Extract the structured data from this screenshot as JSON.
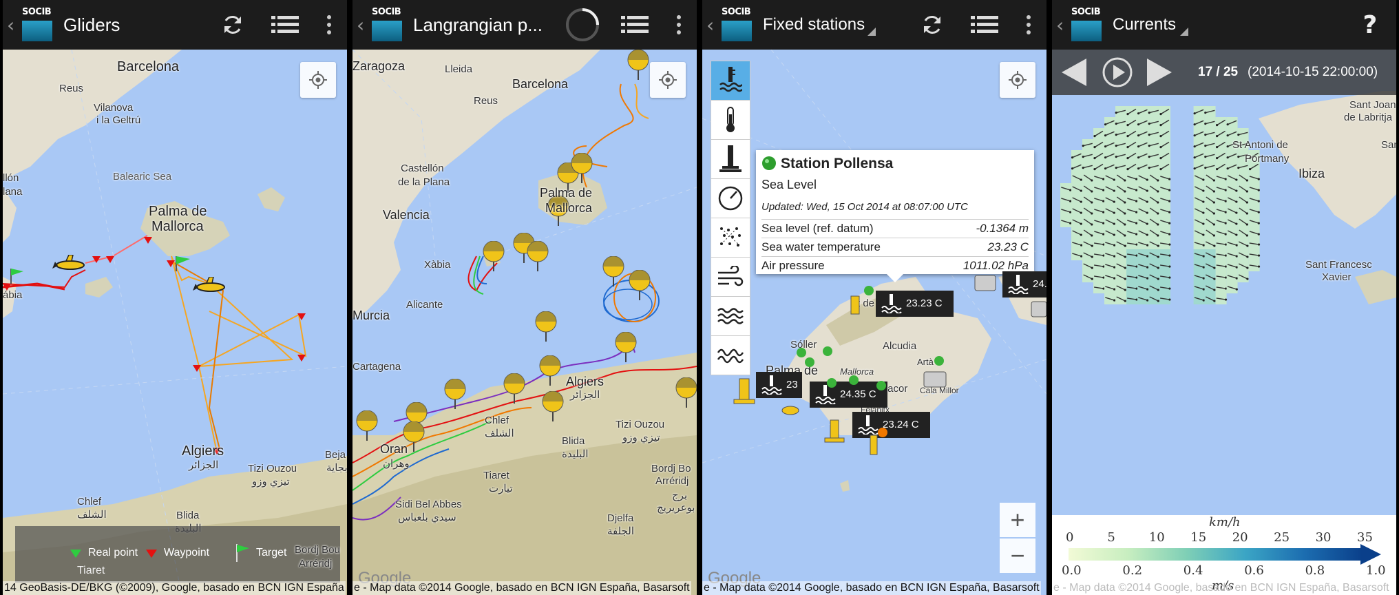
{
  "panels": {
    "gliders": {
      "title": "Gliders",
      "cities": {
        "barcelona": "Barcelona",
        "reus": "Reus",
        "vilanova": "Vilanova",
        "geltru": "i la Geltrú",
        "balearic_sea": "Balearic Sea",
        "llon": "llón",
        "lana": "lana",
        "palma1": "Palma de",
        "palma2": "Mallorca",
        "abia": "ábia",
        "algiers": "Algiers",
        "algiers_ar": "الجزائر",
        "beja": "Beja",
        "beja_ar": "بجاية",
        "chlef": "Chlef",
        "chlef_ar": "الشلف",
        "blida": "Blida",
        "blida_ar": "البليدة",
        "tizi": "Tizi Ouzou",
        "tizi_ar": "تيزي وزو",
        "bordj1": "Bordj Bou",
        "bordj2": "Arréridj",
        "tiaret": "Tiaret"
      },
      "legend": {
        "real_point": "Real point",
        "waypoint": "Waypoint",
        "target": "Target"
      },
      "attribution": "14 GeoBasis-DE/BKG (©2009), Google, basado en BCN IGN España"
    },
    "lagrangian": {
      "title": "Langrangian p...",
      "cities": {
        "zaragoza": "Zaragoza",
        "lleida": "Lleida",
        "barcelona": "Barcelona",
        "reus": "Reus",
        "castellon1": "Castellón",
        "castellon2": "de la Plana",
        "palma1": "Palma de",
        "palma2": "Mallorca",
        "valencia": "Valencia",
        "xabia": "Xàbia",
        "murcia": "Murcia",
        "alicante": "Alicante",
        "cartagena": "Cartagena",
        "algiers": "Algiers",
        "algiers_ar": "الجزائر",
        "tizi": "Tizi Ouzou",
        "tizi_ar": "تيزي وزو",
        "chlef": "Chlef",
        "chlef_ar": "الشلف",
        "blida": "Blida",
        "blida_ar": "البليدة",
        "oran": "Oran",
        "oran_ar": "وهران",
        "tiaret": "Tiaret",
        "tiaret_ar": "تيارت",
        "bordj1": "Bordj Bo",
        "bordj2": "Arréridj",
        "bordj_ar": "برج",
        "bordj_ar2": "بوعريريج",
        "sidi": "Sidi Bel Abbes",
        "sidi_ar": "سيدي بلعباس",
        "djelfa": "Djelfa",
        "djelfa_ar": "الجلفة"
      },
      "attribution": "e - Map data ©2014 Google, basado en BCN IGN España, Basarsoft"
    },
    "fixed": {
      "title": "Fixed stations",
      "popup": {
        "station": "Station Pollensa",
        "subtitle": "Sea Level",
        "updated": "Updated: Wed, 15 Oct 2014 at 08:07:00 UTC",
        "rows": [
          {
            "label": "Sea level (ref. datum)",
            "value": "-0.1364 m"
          },
          {
            "label": "Sea water temperature",
            "value": "23.23 C"
          },
          {
            "label": "Air pressure",
            "value": "1011.02 hPa"
          }
        ]
      },
      "temps": {
        "t1": "23.23 C",
        "t2": "23",
        "t3": "24.35 C",
        "t4": "23.24 C",
        "t5": "24."
      },
      "cities": {
        "soller": "Sóller",
        "alcudia": "Alcudia",
        "mallorca": "Mallorca",
        "palma": "Palma de",
        "manacor": "Manacor",
        "arta": "Artà",
        "cala_millor": "Cala Millor",
        "felanitx": "Felanitx",
        "port_de": "rt de"
      },
      "zoom_in": "+",
      "zoom_out": "−",
      "attribution": "e - Map data ©2014 Google, basado en BCN IGN España, Basarsoft"
    },
    "currents": {
      "title": "Currents",
      "frame": "17 / 25",
      "datetime": "(2014-10-15 22:00:00)",
      "cities": {
        "sant_joan1": "Sant Joan",
        "sant_joan2": "de Labritja",
        "sant_antoni1": "St Antoni de",
        "sant_antoni2": "Portmany",
        "ibiza": "Ibiza",
        "sant_francesc1": "Sant Francesc",
        "sant_francesc2": "Xavier",
        "san": "San"
      },
      "colorbar": {
        "unit_top": "km/h",
        "unit_bottom": "m/s",
        "ticks_top": [
          "0",
          "5",
          "10",
          "15",
          "20",
          "25",
          "30",
          "35"
        ],
        "ticks_bottom": [
          "0.0",
          "0.2",
          "0.4",
          "0.6",
          "0.8",
          "1.0"
        ]
      },
      "attribution": "e - Map data ©2014 Google, basado en BCN IGN España, Basarsoft"
    }
  },
  "logo_text": "SOCIB",
  "google_text": "Google",
  "colors": {
    "sea": "#a9c8f5",
    "land": "#e4dfd0",
    "actionbar": "#1c1c1c",
    "waypoint": "#e31010",
    "real_point": "#2ecc40",
    "track_orange": "#f5a623"
  }
}
